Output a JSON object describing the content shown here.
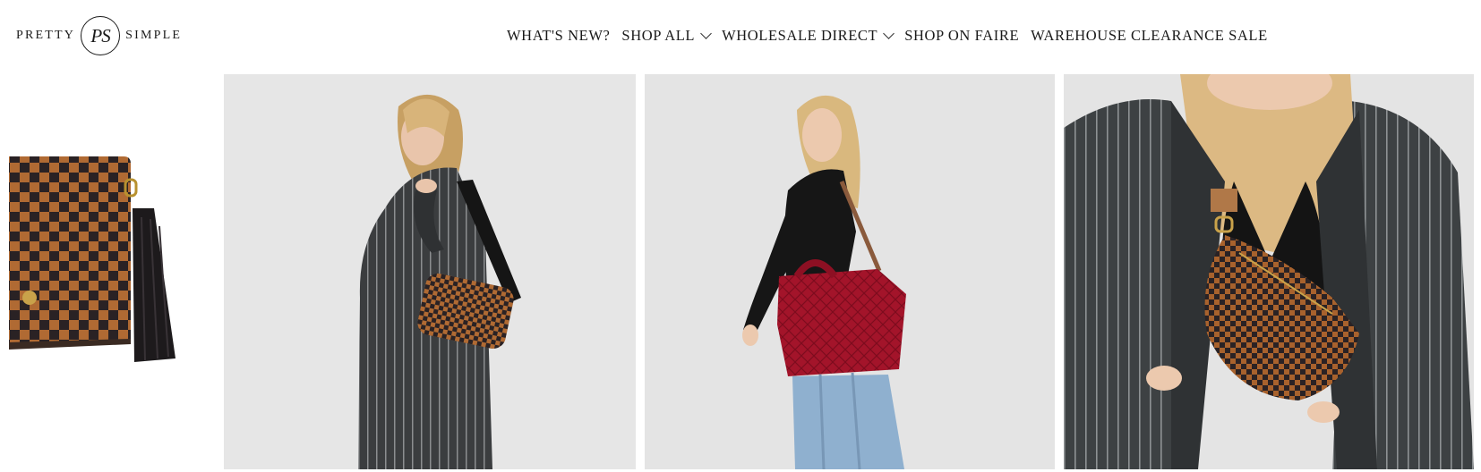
{
  "brand": {
    "word_left": "PRETTY",
    "monogram": "PS",
    "word_right": "SIMPLE"
  },
  "nav": {
    "items": [
      {
        "label": "WHAT'S NEW?",
        "has_dropdown": false
      },
      {
        "label": "SHOP ALL",
        "has_dropdown": true
      },
      {
        "label": "WHOLESALE DIRECT",
        "has_dropdown": true
      },
      {
        "label": "SHOP ON FAIRE",
        "has_dropdown": false
      },
      {
        "label": "WAREHOUSE CLEARANCE SALE",
        "has_dropdown": false
      }
    ]
  },
  "gallery": {
    "panels": [
      {
        "subject": "checkered wallet with tassel",
        "crop": "partial"
      },
      {
        "subject": "model in pinstripe coat with checkered crossbody bag"
      },
      {
        "subject": "model in black top carrying red quilted tote"
      },
      {
        "subject": "close-up of checkered sling bag over pinstripe coat"
      }
    ]
  },
  "colors": {
    "text": "#1a1a1a",
    "background": "#ffffff",
    "photo_backdrop": "#e4e4e4",
    "checker_brown": "#b06a33",
    "checker_dark": "#2a2224",
    "tote_red": "#a3142a"
  }
}
